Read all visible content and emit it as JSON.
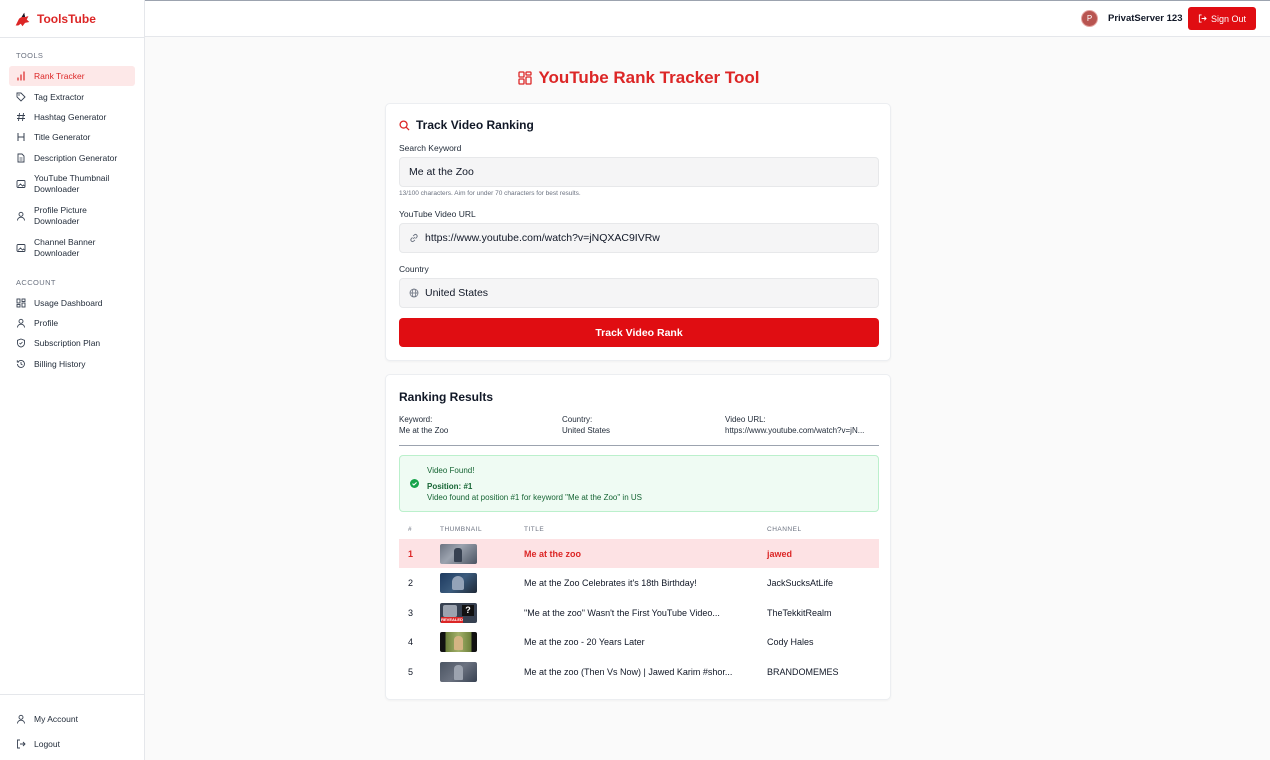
{
  "brand": {
    "name": "ToolsTube",
    "accent": "#dc2626"
  },
  "sidebar": {
    "tools_label": "TOOLS",
    "tools": [
      {
        "label": "Rank Tracker",
        "icon": "bar-chart-icon",
        "active": true
      },
      {
        "label": "Tag Extractor",
        "icon": "tag-icon"
      },
      {
        "label": "Hashtag Generator",
        "icon": "hash-icon"
      },
      {
        "label": "Title Generator",
        "icon": "heading-icon"
      },
      {
        "label": "Description Generator",
        "icon": "document-icon"
      },
      {
        "label": "YouTube Thumbnail Downloader",
        "icon": "image-icon"
      },
      {
        "label": "Profile Picture Downloader",
        "icon": "user-icon"
      },
      {
        "label": "Channel Banner Downloader",
        "icon": "image-icon"
      }
    ],
    "account_label": "ACCOUNT",
    "account": [
      {
        "label": "Usage Dashboard",
        "icon": "dashboard-icon"
      },
      {
        "label": "Profile",
        "icon": "user-icon"
      },
      {
        "label": "Subscription Plan",
        "icon": "shield-icon"
      },
      {
        "label": "Billing History",
        "icon": "history-icon"
      }
    ],
    "bottom": [
      {
        "label": "My Account",
        "icon": "user-icon"
      },
      {
        "label": "Logout",
        "icon": "logout-icon"
      }
    ]
  },
  "header": {
    "avatar_letter": "P",
    "user_name": "PrivatServer 123",
    "signout_label": "Sign Out"
  },
  "main": {
    "page_title": "YouTube Rank Tracker Tool",
    "form": {
      "title": "Track Video Ranking",
      "keyword_label": "Search Keyword",
      "keyword_value": "Me at the Zoo",
      "keyword_hint": "13/100 characters. Aim for under 70 characters for best results.",
      "url_label": "YouTube Video URL",
      "url_value": "https://www.youtube.com/watch?v=jNQXAC9IVRw",
      "country_label": "Country",
      "country_value": "United States",
      "submit_label": "Track Video Rank"
    },
    "results": {
      "title": "Ranking Results",
      "keyword_label": "Keyword:",
      "keyword_value": "Me at the Zoo",
      "country_label": "Country:",
      "country_value": "United States",
      "url_label": "Video URL:",
      "url_value": "https://www.youtube.com/watch?v=jN...",
      "found_title": "Video Found!",
      "found_position": "Position: #1",
      "found_detail": "Video found at position #1 for keyword \"Me at the Zoo\" in US",
      "columns": [
        "#",
        "THUMBNAIL",
        "TITLE",
        "CHANNEL"
      ],
      "rows": [
        {
          "rank": "1",
          "title": "Me at the zoo",
          "channel": "jawed",
          "highlight": true
        },
        {
          "rank": "2",
          "title": "Me at the Zoo Celebrates it's 18th Birthday!",
          "channel": "JackSucksAtLife"
        },
        {
          "rank": "3",
          "title": "\"Me at the zoo\" Wasn't the First YouTube Video...",
          "channel": "TheTekkitRealm",
          "thumb_text": "REVEALED"
        },
        {
          "rank": "4",
          "title": "Me at the zoo - 20 Years Later",
          "channel": "Cody Hales"
        },
        {
          "rank": "5",
          "title": "Me at the zoo (Then Vs Now) | Jawed Karim #shor...",
          "channel": "BRANDOMEMES"
        }
      ]
    }
  },
  "colors": {
    "primary": "#e00d12",
    "success_bg": "#effbf3",
    "success_text": "#166534",
    "highlight_row": "#fde2e4"
  }
}
